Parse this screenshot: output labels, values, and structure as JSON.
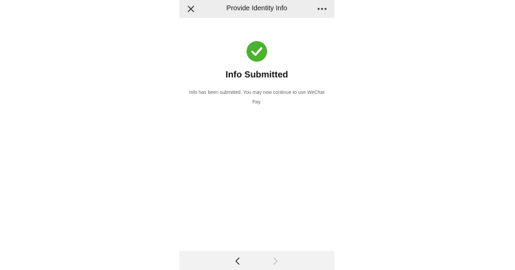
{
  "navbar": {
    "title": "Provide Identity Info",
    "close_icon": "close-icon",
    "more_icon": "more-icon"
  },
  "status": {
    "icon": "check-circle-icon",
    "icon_color": "#4ab22d",
    "title": "Info Submitted",
    "message": "Info has been submitted. You may now continue to use WeChat Pay."
  },
  "toolbar": {
    "back_icon": "chevron-left-icon",
    "forward_icon": "chevron-right-icon",
    "forward_enabled": false
  },
  "colors": {
    "navbar_bg": "#ededed",
    "toolbar_bg": "#f2f2f2",
    "success_green": "#4ab22d"
  }
}
